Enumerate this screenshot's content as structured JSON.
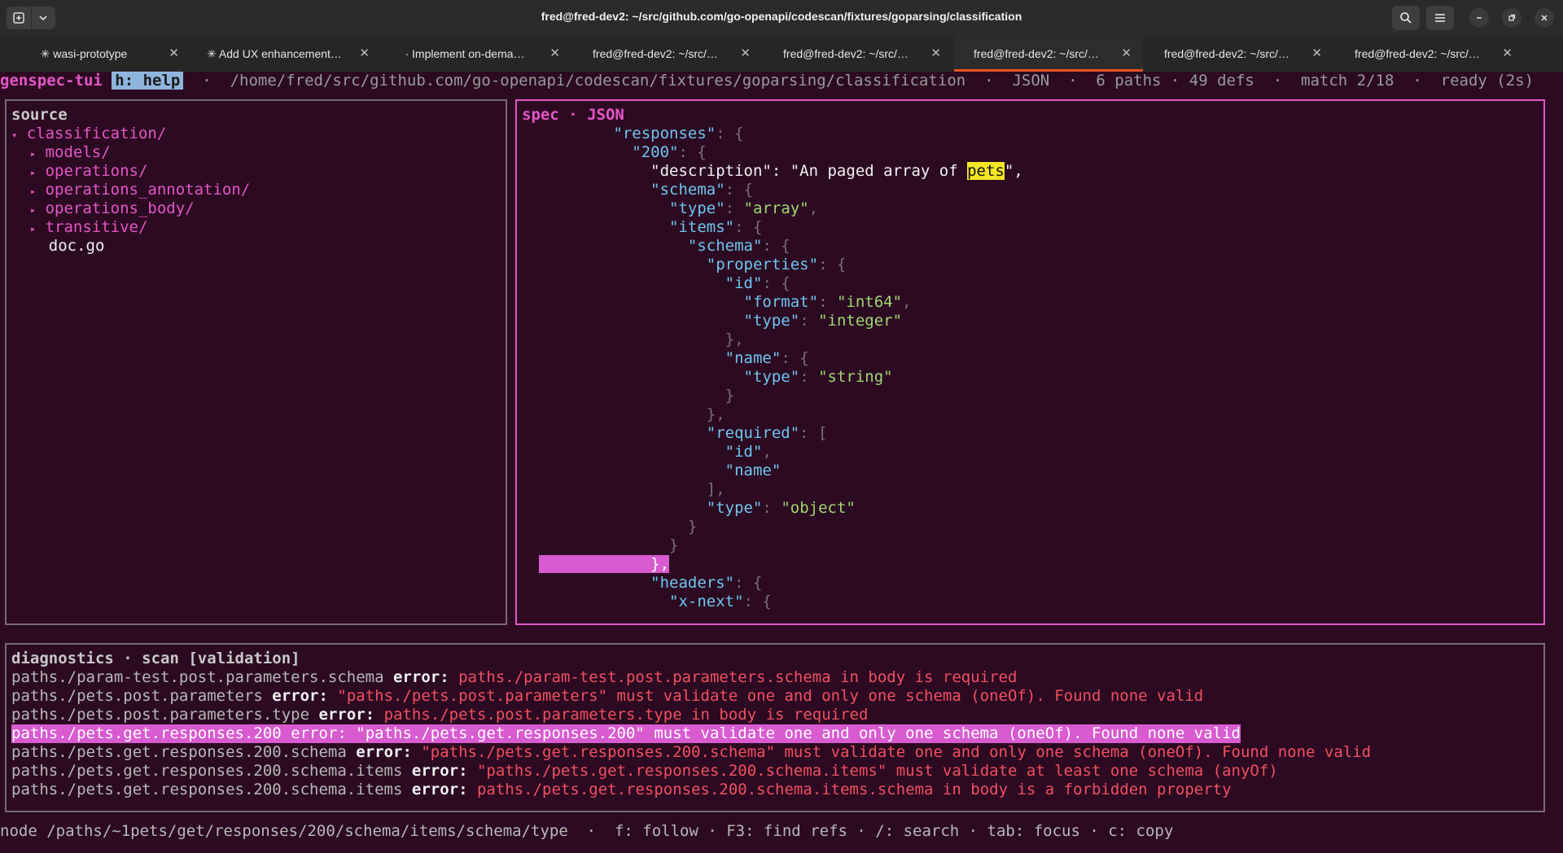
{
  "window": {
    "title": "fred@fred-dev2: ~/src/github.com/go-openapi/codescan/fixtures/goparsing/classification"
  },
  "tabs": [
    {
      "label": "✳ wasi-prototype"
    },
    {
      "label": "✳ Add UX enhancement…"
    },
    {
      "label": "· Implement on-dema…"
    },
    {
      "label": "fred@fred-dev2: ~/src/…"
    },
    {
      "label": "fred@fred-dev2: ~/src/…"
    },
    {
      "label": "fred@fred-dev2: ~/src/…",
      "active": true
    },
    {
      "label": "fred@fred-dev2: ~/src/…"
    },
    {
      "label": "fred@fred-dev2: ~/src/…"
    }
  ],
  "status": {
    "app_name": "genspec-tui",
    "help": "h: help",
    "rest": "  ·  /home/fred/src/github.com/go-openapi/codescan/fixtures/goparsing/classification  ·  JSON  ·  6 paths · 49 defs  ·  match 2/18  ·  ready (2s)"
  },
  "source_panel": {
    "title": "source",
    "root": "classification/",
    "items": [
      {
        "label": "models/"
      },
      {
        "label": "operations/"
      },
      {
        "label": "operations_annotation/"
      },
      {
        "label": "operations_body/"
      },
      {
        "label": "transitive/"
      }
    ],
    "file": "doc.go"
  },
  "spec_panel": {
    "title": "spec · JSON",
    "lines": [
      {
        "i": 5,
        "k": "responses",
        "p": ": {"
      },
      {
        "i": 6,
        "k": "200",
        "p": ": {"
      },
      {
        "i": 7,
        "w": "\"description\": \"An paged array of ",
        "hl": "pets",
        "w2": "\","
      },
      {
        "i": 7,
        "k": "schema",
        "p": ": {"
      },
      {
        "i": 8,
        "k": "type",
        "p": ": ",
        "s": "\"array\"",
        "p2": ","
      },
      {
        "i": 8,
        "k": "items",
        "p": ": {"
      },
      {
        "i": 9,
        "k": "schema",
        "p": ": {"
      },
      {
        "i": 10,
        "k": "properties",
        "p": ": {"
      },
      {
        "i": 11,
        "k": "id",
        "p": ": {"
      },
      {
        "i": 12,
        "k": "format",
        "p": ": ",
        "s": "\"int64\"",
        "p2": ","
      },
      {
        "i": 12,
        "k": "type",
        "p": ": ",
        "s": "\"integer\""
      },
      {
        "i": 11,
        "p": "},"
      },
      {
        "i": 11,
        "k": "name",
        "p": ": {"
      },
      {
        "i": 12,
        "k": "type",
        "p": ": ",
        "s": "\"string\""
      },
      {
        "i": 11,
        "p": "}"
      },
      {
        "i": 10,
        "p": "},"
      },
      {
        "i": 10,
        "k": "required",
        "p": ": ["
      },
      {
        "i": 11,
        "s2": "\"id\"",
        "p": ","
      },
      {
        "i": 11,
        "s2": "\"name\""
      },
      {
        "i": 10,
        "p": "],"
      },
      {
        "i": 10,
        "k": "type",
        "p": ": ",
        "s": "\"object\""
      },
      {
        "i": 9,
        "p": "}"
      },
      {
        "i": 8,
        "p": "}"
      },
      {
        "i": 7,
        "sel": "},"
      },
      {
        "i": 7,
        "k": "headers",
        "p": ": {"
      },
      {
        "i": 8,
        "k": "x-next",
        "p": ": {"
      }
    ]
  },
  "diagnostics": {
    "title": "diagnostics · scan [validation]",
    "rows": [
      {
        "path": "paths./param-test.post.parameters.schema",
        "level": "error",
        "msg": "paths./param-test.post.parameters.schema in body is required"
      },
      {
        "path": "paths./pets.post.parameters",
        "level": "error",
        "msg": "\"paths./pets.post.parameters\" must validate one and only one schema (oneOf). Found none valid"
      },
      {
        "path": "paths./pets.post.parameters.type",
        "level": "error",
        "msg": "paths./pets.post.parameters.type in body is required"
      },
      {
        "path": "paths./pets.get.responses.200",
        "level": "error",
        "msg": "\"paths./pets.get.responses.200\" must validate one and only one schema (oneOf). Found none valid",
        "selected": true
      },
      {
        "path": "paths./pets.get.responses.200.schema",
        "level": "error",
        "msg": "\"paths./pets.get.responses.200.schema\" must validate one and only one schema (oneOf). Found none valid"
      },
      {
        "path": "paths./pets.get.responses.200.schema.items",
        "level": "error",
        "msg": "\"paths./pets.get.responses.200.schema.items\" must validate at least one schema (anyOf)"
      },
      {
        "path": "paths./pets.get.responses.200.schema.items",
        "level": "error",
        "msg": "paths./pets.get.responses.200.schema.items.schema in body is a forbidden property"
      }
    ]
  },
  "footer": "node /paths/~1pets/get/responses/200/schema/items/schema/type  ·  f: follow · F3: find refs · /: search · tab: focus · c: copy",
  "colors": {
    "accent": "#e455c6",
    "error": "#f05060",
    "highlight": "#f5e625"
  }
}
